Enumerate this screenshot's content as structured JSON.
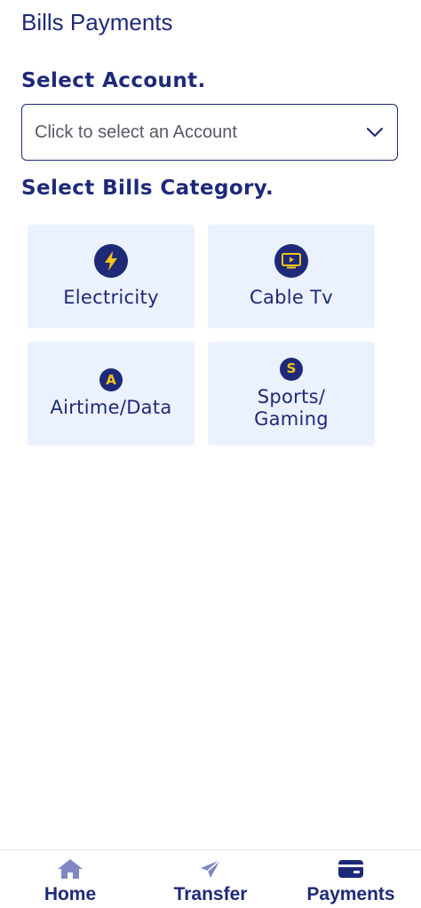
{
  "page": {
    "title": "Bills Payments"
  },
  "account": {
    "section_label": "Select Account.",
    "placeholder": "Click to select an Account"
  },
  "bills": {
    "section_label": "Select Bills Category.",
    "categories": [
      {
        "label": "Electricity",
        "icon": "lightning-icon"
      },
      {
        "label": "Cable Tv",
        "icon": "tv-icon"
      },
      {
        "label": "Airtime/Data",
        "icon": "letter-a-icon",
        "icon_text": "A"
      },
      {
        "label": "Sports/\nGaming",
        "icon": "letter-s-icon",
        "icon_text": "S"
      }
    ]
  },
  "nav": {
    "items": [
      {
        "label": "Home",
        "icon": "home-icon"
      },
      {
        "label": "Transfer",
        "icon": "send-icon"
      },
      {
        "label": "Payments",
        "icon": "card-icon",
        "active": true
      }
    ]
  },
  "colors": {
    "primary": "#1e2a78",
    "accent": "#f5c518",
    "tile_bg": "#ebf1fd",
    "inactive_icon": "#7f88c2"
  }
}
